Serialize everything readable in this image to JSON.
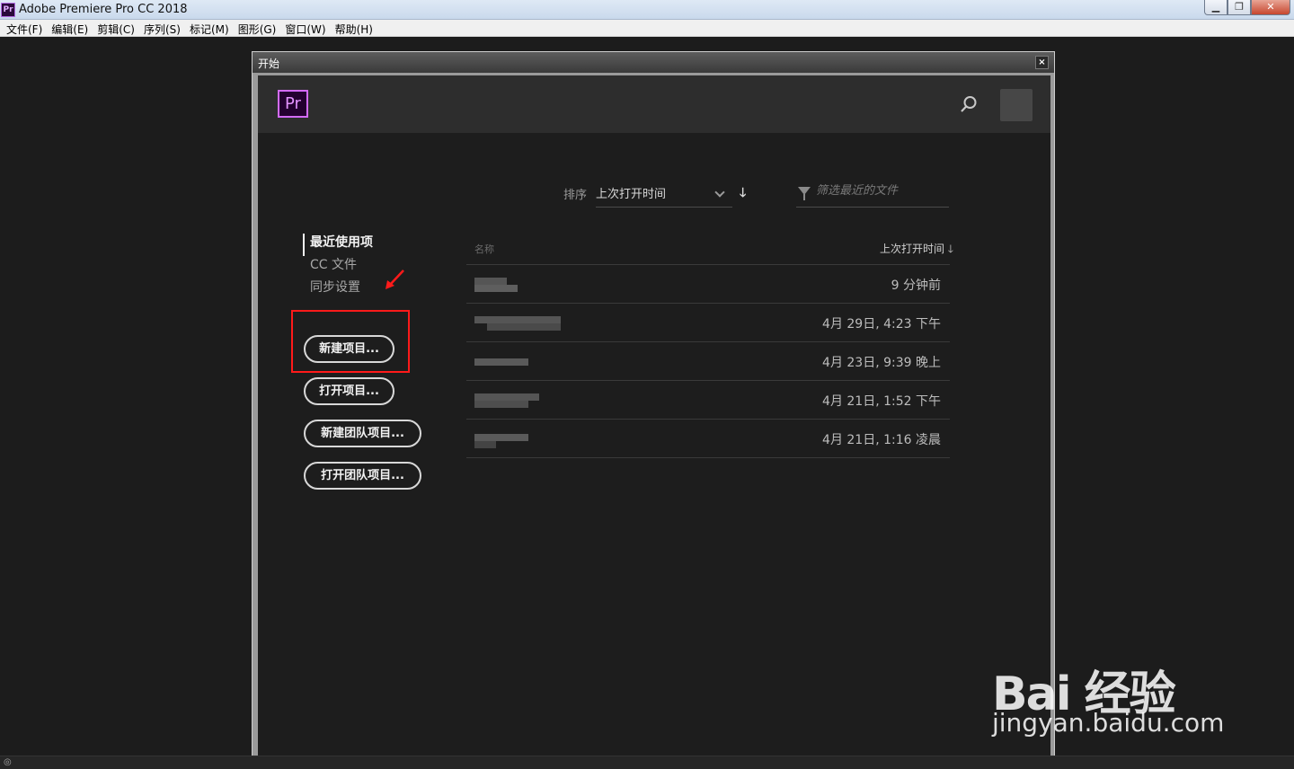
{
  "window": {
    "title": "Adobe Premiere Pro CC 2018",
    "app_icon_label": "Pr",
    "controls": [
      "▁",
      "❐",
      "✕"
    ]
  },
  "menubar": [
    "文件(F)",
    "编辑(E)",
    "剪辑(C)",
    "序列(S)",
    "标记(M)",
    "图形(G)",
    "窗口(W)",
    "帮助(H)"
  ],
  "dialog": {
    "title": "开始",
    "close_label": "×",
    "logo": "Pr",
    "sort": {
      "label": "排序",
      "value": "上次打开时间",
      "direction_glyph": "🡓"
    },
    "filter": {
      "placeholder": "筛选最近的文件"
    },
    "nav": [
      "最近使用项",
      "CC 文件",
      "同步设置"
    ],
    "buttons": {
      "new_project": "新建项目...",
      "open_project": "打开项目...",
      "new_team_project": "新建团队项目...",
      "open_team_project": "打开团队项目..."
    },
    "table": {
      "col_name": "名称",
      "col_time": "上次打开时间 🡓",
      "rows": [
        {
          "time": "9 分钟前"
        },
        {
          "time": "4月 29日, 4:23 下午"
        },
        {
          "time": "4月 23日, 9:39 晚上"
        },
        {
          "time": "4月 21日, 1:52 下午"
        },
        {
          "time": "4月 21日, 1:16 凌晨"
        }
      ]
    }
  },
  "watermark": {
    "main": "Bai 经验",
    "sub": "jingyan.baidu.com"
  },
  "colors": {
    "accent": "#d46bff",
    "highlight": "#ff1a1a"
  }
}
